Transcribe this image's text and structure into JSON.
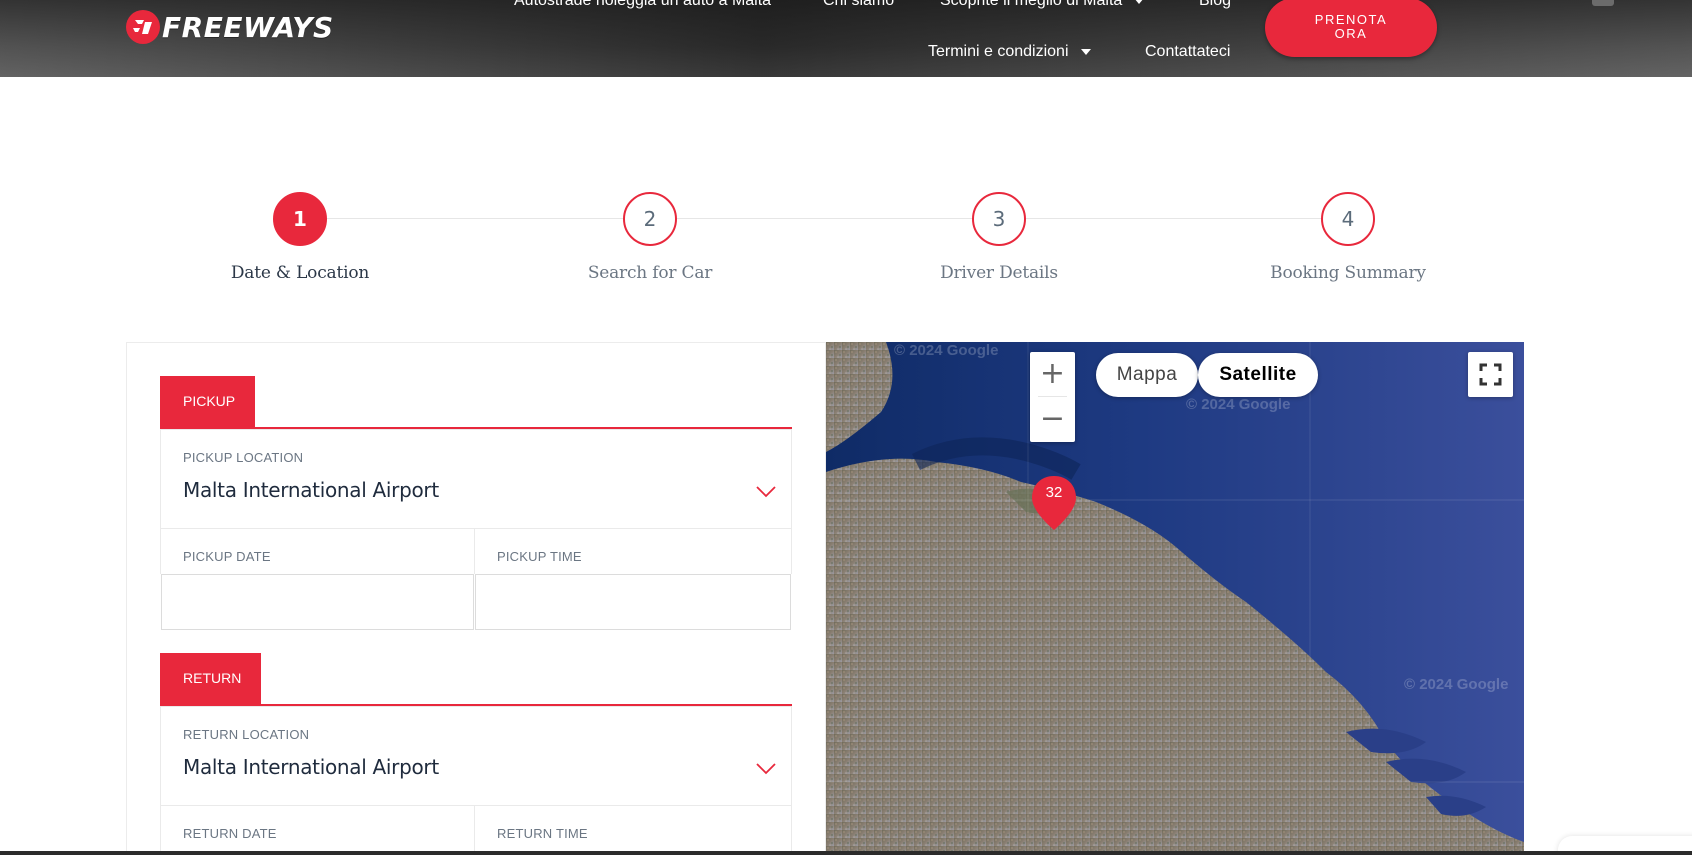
{
  "header": {
    "brand": "FREEWAYS",
    "nav": {
      "autostrade": "Autostrade noleggia un auto a Malta",
      "chi_siamo": "Chi siamo",
      "scoprite": "Scoprite il meglio di Malta",
      "blog": "Blog",
      "termini": "Termini e condizioni",
      "contattateci": "Contattateci"
    },
    "cta": "PRENOTA ORA"
  },
  "steps": [
    {
      "number": "1",
      "label": "Date & Location",
      "active": true
    },
    {
      "number": "2",
      "label": "Search for Car",
      "active": false
    },
    {
      "number": "3",
      "label": "Driver Details",
      "active": false
    },
    {
      "number": "4",
      "label": "Booking Summary",
      "active": false
    }
  ],
  "pickup": {
    "tab": "PICKUP",
    "location_label": "PICKUP LOCATION",
    "location_value": "Malta International Airport",
    "date_label": "PICKUP DATE",
    "date_value": "",
    "time_label": "PICKUP TIME",
    "time_value": ""
  },
  "return": {
    "tab": "RETURN",
    "location_label": "RETURN LOCATION",
    "location_value": "Malta International Airport",
    "date_label": "RETURN DATE",
    "time_label": "RETURN TIME"
  },
  "map": {
    "type_map": "Mappa",
    "type_satellite": "Satellite",
    "selected_type": "Satellite",
    "zoom_in": "+",
    "zoom_out": "−",
    "marker_count": "32",
    "watermark": "© 2024 Google",
    "icons": [
      "plus-icon",
      "minus-icon",
      "fullscreen-icon",
      "map-marker-icon"
    ]
  },
  "colors": {
    "accent": "#e8283c",
    "text_dark": "#1f2b3d",
    "text_muted": "#6b7683",
    "sea": "#273a82"
  }
}
